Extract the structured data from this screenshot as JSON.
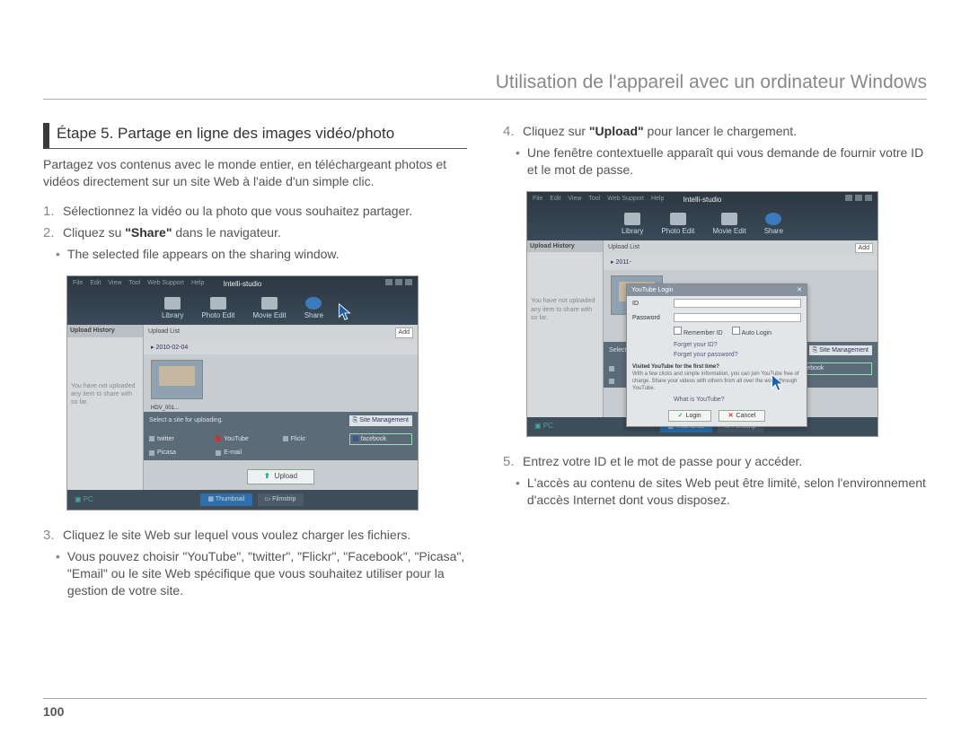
{
  "header": "Utilisation de l'appareil avec un ordinateur Windows",
  "section_title": "Étape 5. Partage en ligne des images vidéo/photo",
  "intro": "Partagez vos contenus avec le monde entier, en téléchargeant photos et vidéos directement sur un site Web à l'aide d'un simple clic.",
  "steps": {
    "s1": {
      "num": "1.",
      "text": "Sélectionnez la vidéo ou la photo que vous souhaitez partager."
    },
    "s2": {
      "num": "2.",
      "pre": "Cliquez su ",
      "strong": "\"Share\"",
      "post": " dans le navigateur.",
      "b1": "The selected file appears on the sharing window."
    },
    "s3": {
      "num": "3.",
      "text": "Cliquez le site Web sur lequel vous voulez charger les fichiers.",
      "b1": "Vous pouvez choisir \"YouTube\", \"twitter\", \"Flickr\", \"Facebook\", \"Picasa\", \"Email\" ou le site Web spécifique que vous souhaitez utiliser pour la gestion de votre site."
    },
    "s4": {
      "num": "4.",
      "pre": "Cliquez sur ",
      "strong": "\"Upload\"",
      "post": " pour lancer le chargement.",
      "b1": "Une fenêtre contextuelle apparaît qui vous demande de fournir votre ID et le mot de passe."
    },
    "s5": {
      "num": "5.",
      "text": "Entrez votre ID et le mot de passe pour y accéder.",
      "b1": "L'accès au contenu de sites Web peut être limité, selon l'environnement d'accès Internet dont vous disposez."
    }
  },
  "fig": {
    "logo": "Intelli-studio",
    "menus": [
      "File",
      "Edit",
      "View",
      "Tool",
      "Web Support",
      "Help"
    ],
    "tabs": [
      "Library",
      "Photo Edit",
      "Movie Edit",
      "Share"
    ],
    "side_head": "Upload History",
    "list_head": "Upload List",
    "add": "Add",
    "date": "2010-02-04",
    "thumb_name": "HDV_001...",
    "select_label": "Select a site for uploading.",
    "site_mgmt": "Site Management",
    "sites": [
      "twitter",
      "YouTube",
      "Flickr",
      "facebook",
      "Picasa",
      "E-mail"
    ],
    "upload": "Upload",
    "pc": "PC",
    "bottom1": "Thumbnail",
    "bottom2": "Filmstrip",
    "side_empty": "You have not uploaded any item to share with so far.",
    "fb_pill": "facebook"
  },
  "dialog": {
    "title": "YouTube Login",
    "id": "ID",
    "pw": "Password",
    "remember": "Remember ID",
    "auto": "Auto Login",
    "forgot_id": "Forget your ID?",
    "forgot_pw": "Forget your password?",
    "note_head": "Visited YouTube for the first time?",
    "note_body": "With a few clicks and simple information, you can join YouTube free of charge. Share your videos with others from all over the world through YouTube.",
    "what": "What is YouTube?",
    "login": "Login",
    "cancel": "Cancel"
  },
  "page_number": "100"
}
